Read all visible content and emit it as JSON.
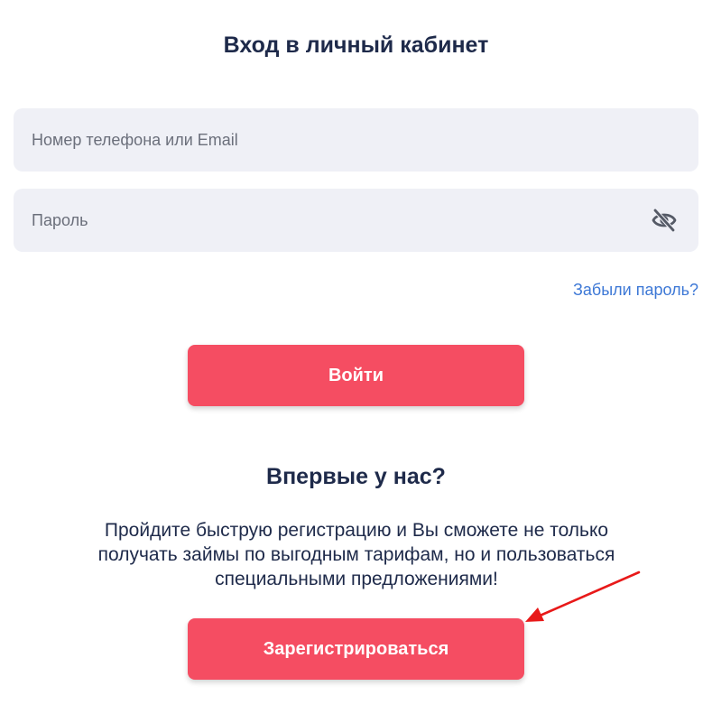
{
  "login": {
    "title": "Вход в личный кабинет",
    "login_field": {
      "value": "",
      "placeholder": "Номер телефона или Email"
    },
    "password_field": {
      "value": "",
      "placeholder": "Пароль",
      "toggle_icon": "eye-slash-icon"
    },
    "forgot_link": "Забыли пароль?",
    "submit_label": "Войти"
  },
  "register": {
    "title": "Впервые у нас?",
    "description": "Пройдите быструю регистрацию и Вы сможете не только получать займы по выгодным тарифам, но и пользоваться специальными предложениями!",
    "button_label": "Зарегистрироваться"
  },
  "colors": {
    "accent": "#f54d62",
    "heading": "#1e2a4a",
    "link": "#3d78d6",
    "field_bg": "#eff0f6",
    "annotation_arrow": "#e81919"
  }
}
